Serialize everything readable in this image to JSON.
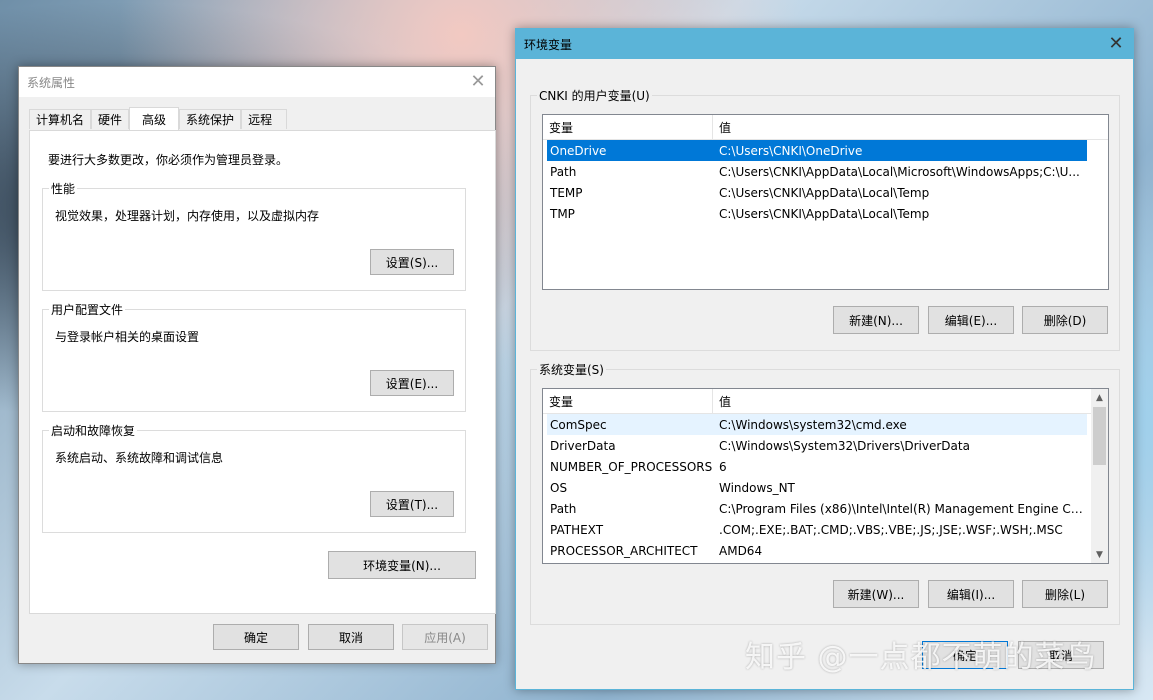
{
  "system_properties": {
    "title": "系统属性",
    "tabs": [
      "计算机名",
      "硬件",
      "高级",
      "系统保护",
      "远程"
    ],
    "admin_notice": "要进行大多数更改，你必须作为管理员登录。",
    "performance": {
      "title": "性能",
      "description": "视觉效果，处理器计划，内存使用，以及虚拟内存",
      "button": "设置(S)..."
    },
    "user_profiles": {
      "title": "用户配置文件",
      "description": "与登录帐户相关的桌面设置",
      "button": "设置(E)..."
    },
    "startup_recovery": {
      "title": "启动和故障恢复",
      "description": "系统启动、系统故障和调试信息",
      "button": "设置(T)..."
    },
    "env_button": "环境变量(N)...",
    "ok": "确定",
    "cancel": "取消",
    "apply": "应用(A)"
  },
  "env_vars": {
    "title": "环境变量",
    "user_section": "CNKI 的用户变量(U)",
    "col_var": "变量",
    "col_value": "值",
    "user_vars": [
      {
        "name": "OneDrive",
        "value": "C:\\Users\\CNKI\\OneDrive"
      },
      {
        "name": "Path",
        "value": "C:\\Users\\CNKI\\AppData\\Local\\Microsoft\\WindowsApps;C:\\U..."
      },
      {
        "name": "TEMP",
        "value": "C:\\Users\\CNKI\\AppData\\Local\\Temp"
      },
      {
        "name": "TMP",
        "value": "C:\\Users\\CNKI\\AppData\\Local\\Temp"
      }
    ],
    "user_buttons": {
      "new": "新建(N)...",
      "edit": "编辑(E)...",
      "delete": "删除(D)"
    },
    "system_section": "系统变量(S)",
    "system_vars": [
      {
        "name": "ComSpec",
        "value": "C:\\Windows\\system32\\cmd.exe"
      },
      {
        "name": "DriverData",
        "value": "C:\\Windows\\System32\\Drivers\\DriverData"
      },
      {
        "name": "NUMBER_OF_PROCESSORS",
        "value": "6"
      },
      {
        "name": "OS",
        "value": "Windows_NT"
      },
      {
        "name": "Path",
        "value": "C:\\Program Files (x86)\\Intel\\Intel(R) Management Engine Co..."
      },
      {
        "name": "PATHEXT",
        "value": ".COM;.EXE;.BAT;.CMD;.VBS;.VBE;.JS;.JSE;.WSF;.WSH;.MSC"
      },
      {
        "name": "PROCESSOR_ARCHITECT",
        "value": "AMD64"
      }
    ],
    "system_buttons": {
      "new": "新建(W)...",
      "edit": "编辑(I)...",
      "delete": "删除(L)"
    },
    "ok": "确定",
    "cancel": "取消"
  },
  "watermark": "知乎 @一点都不萌的菜鸟",
  "colors": {
    "selection": "#0078d7",
    "title_active": "#5bb4d8"
  }
}
